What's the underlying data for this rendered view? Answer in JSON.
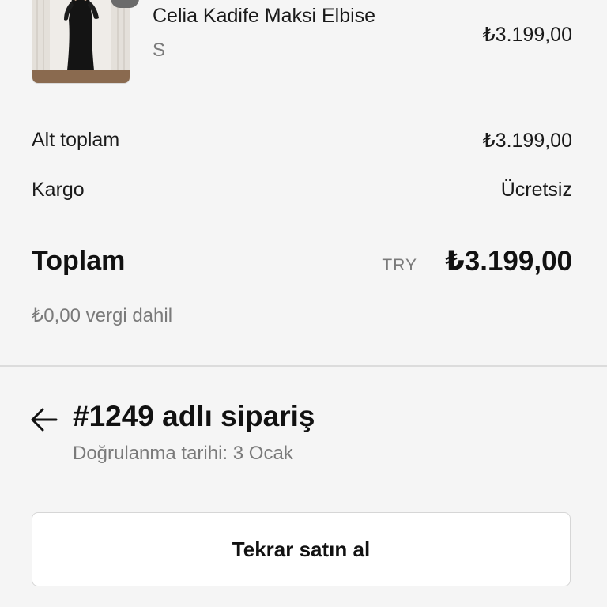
{
  "product": {
    "name": "Celia Kadife Maksi Elbise",
    "variant": "S",
    "price": "₺3.199,00"
  },
  "summary": {
    "subtotal_label": "Alt toplam",
    "subtotal_value": "₺3.199,00",
    "shipping_label": "Kargo",
    "shipping_value": "Ücretsiz",
    "total_label": "Toplam",
    "total_currency": "TRY",
    "total_value": "₺3.199,00",
    "tax_note": "₺0,00 vergi dahil"
  },
  "order": {
    "title": "#1249 adlı sipariş",
    "confirmed_date": "Doğrulanma tarihi: 3 Ocak"
  },
  "actions": {
    "buy_again_label": "Tekrar satın al"
  },
  "icons": {
    "back": "arrow-left-icon",
    "product_image": "dress-photo"
  }
}
